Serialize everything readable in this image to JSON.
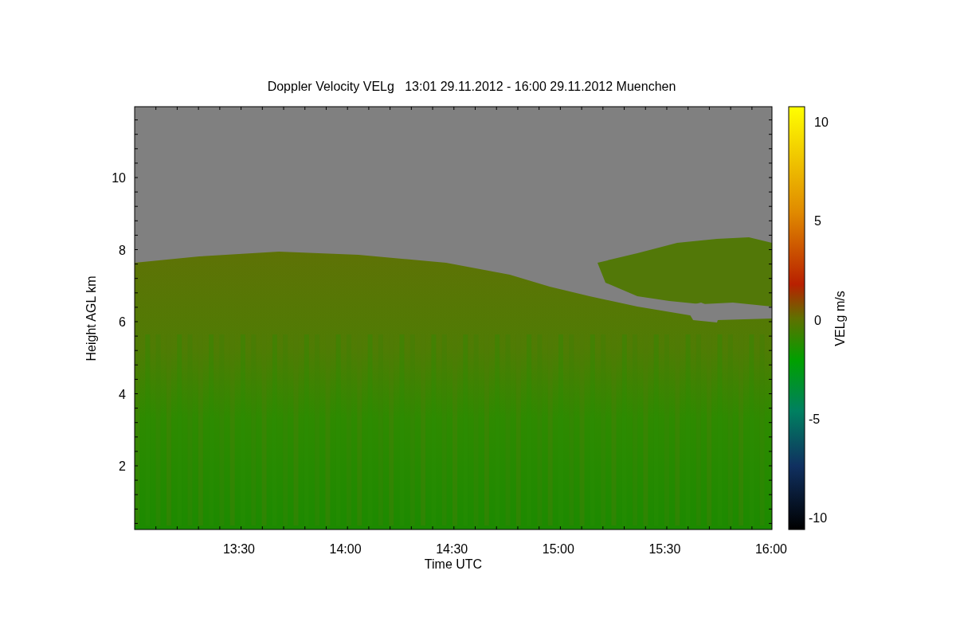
{
  "title": "Doppler Velocity VELg   13:01 29.11.2012 - 16:00 29.11.2012 Muenchen",
  "y_axis": {
    "label": "Height AGL km",
    "ticks": [
      "10",
      "8",
      "6",
      "4",
      "2"
    ]
  },
  "x_axis": {
    "label": "Time UTC",
    "ticks": [
      "13:30",
      "14:00",
      "14:30",
      "15:00",
      "15:30",
      "16:00"
    ]
  },
  "colorbar": {
    "label": "VELg m/s",
    "ticks": [
      "10",
      "5",
      "0",
      "-5",
      "-10"
    ]
  }
}
